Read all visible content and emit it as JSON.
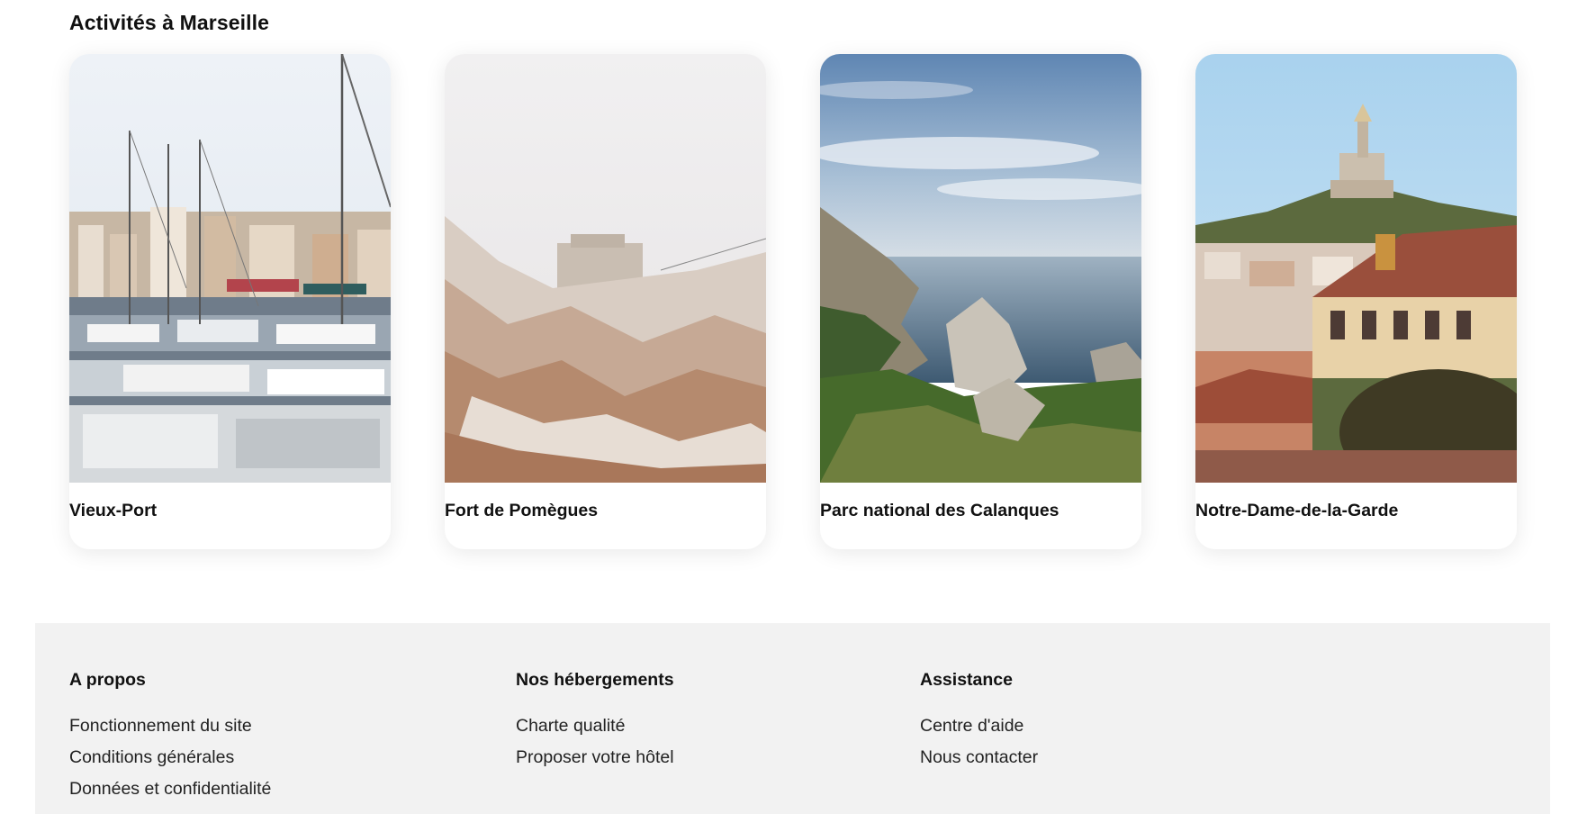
{
  "activities": {
    "title": "Activités à Marseille",
    "cards": [
      {
        "name": "Vieux-Port",
        "image": "harbor-sailboats-photo"
      },
      {
        "name": "Fort de Pomègues",
        "image": "island-fort-rocks-photo"
      },
      {
        "name": "Parc national des Calanques",
        "image": "calanques-cliffs-sea-photo"
      },
      {
        "name": "Notre-Dame-de-la-Garde",
        "image": "basilica-hill-city-photo"
      }
    ]
  },
  "footer": {
    "columns": [
      {
        "heading": "A propos",
        "links": [
          "Fonctionnement du site",
          "Conditions générales",
          "Données et confidentialité"
        ]
      },
      {
        "heading": "Nos hébergements",
        "links": [
          "Charte qualité",
          "Proposer votre hôtel"
        ]
      },
      {
        "heading": "Assistance",
        "links": [
          "Centre d'aide",
          "Nous contacter"
        ]
      }
    ]
  },
  "colors": {
    "footer_bg": "#f2f2f2",
    "text": "#111111"
  }
}
